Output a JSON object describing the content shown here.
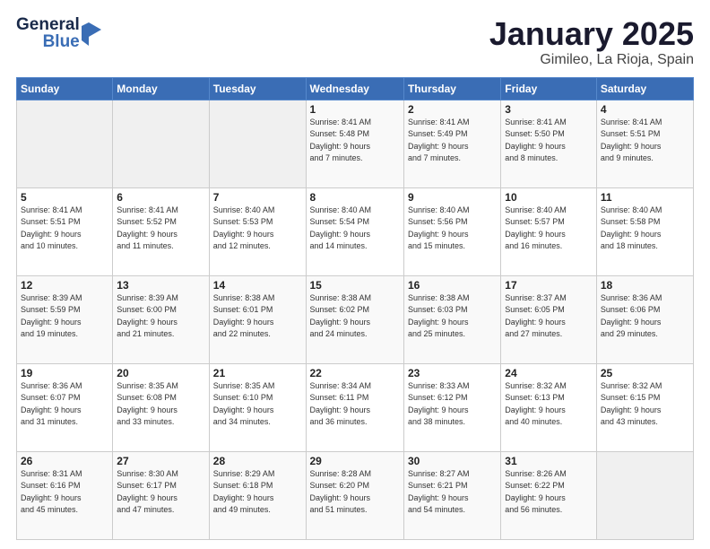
{
  "header": {
    "logo_general": "General",
    "logo_blue": "Blue",
    "month_title": "January 2025",
    "location": "Gimileo, La Rioja, Spain"
  },
  "days_of_week": [
    "Sunday",
    "Monday",
    "Tuesday",
    "Wednesday",
    "Thursday",
    "Friday",
    "Saturday"
  ],
  "weeks": [
    [
      {
        "day": "",
        "sunrise": "",
        "sunset": "",
        "daylight": ""
      },
      {
        "day": "",
        "sunrise": "",
        "sunset": "",
        "daylight": ""
      },
      {
        "day": "",
        "sunrise": "",
        "sunset": "",
        "daylight": ""
      },
      {
        "day": "1",
        "sunrise": "Sunrise: 8:41 AM",
        "sunset": "Sunset: 5:48 PM",
        "daylight": "Daylight: 9 hours and 7 minutes."
      },
      {
        "day": "2",
        "sunrise": "Sunrise: 8:41 AM",
        "sunset": "Sunset: 5:49 PM",
        "daylight": "Daylight: 9 hours and 7 minutes."
      },
      {
        "day": "3",
        "sunrise": "Sunrise: 8:41 AM",
        "sunset": "Sunset: 5:50 PM",
        "daylight": "Daylight: 9 hours and 8 minutes."
      },
      {
        "day": "4",
        "sunrise": "Sunrise: 8:41 AM",
        "sunset": "Sunset: 5:51 PM",
        "daylight": "Daylight: 9 hours and 9 minutes."
      }
    ],
    [
      {
        "day": "5",
        "sunrise": "Sunrise: 8:41 AM",
        "sunset": "Sunset: 5:51 PM",
        "daylight": "Daylight: 9 hours and 10 minutes."
      },
      {
        "day": "6",
        "sunrise": "Sunrise: 8:41 AM",
        "sunset": "Sunset: 5:52 PM",
        "daylight": "Daylight: 9 hours and 11 minutes."
      },
      {
        "day": "7",
        "sunrise": "Sunrise: 8:40 AM",
        "sunset": "Sunset: 5:53 PM",
        "daylight": "Daylight: 9 hours and 12 minutes."
      },
      {
        "day": "8",
        "sunrise": "Sunrise: 8:40 AM",
        "sunset": "Sunset: 5:54 PM",
        "daylight": "Daylight: 9 hours and 14 minutes."
      },
      {
        "day": "9",
        "sunrise": "Sunrise: 8:40 AM",
        "sunset": "Sunset: 5:56 PM",
        "daylight": "Daylight: 9 hours and 15 minutes."
      },
      {
        "day": "10",
        "sunrise": "Sunrise: 8:40 AM",
        "sunset": "Sunset: 5:57 PM",
        "daylight": "Daylight: 9 hours and 16 minutes."
      },
      {
        "day": "11",
        "sunrise": "Sunrise: 8:40 AM",
        "sunset": "Sunset: 5:58 PM",
        "daylight": "Daylight: 9 hours and 18 minutes."
      }
    ],
    [
      {
        "day": "12",
        "sunrise": "Sunrise: 8:39 AM",
        "sunset": "Sunset: 5:59 PM",
        "daylight": "Daylight: 9 hours and 19 minutes."
      },
      {
        "day": "13",
        "sunrise": "Sunrise: 8:39 AM",
        "sunset": "Sunset: 6:00 PM",
        "daylight": "Daylight: 9 hours and 21 minutes."
      },
      {
        "day": "14",
        "sunrise": "Sunrise: 8:38 AM",
        "sunset": "Sunset: 6:01 PM",
        "daylight": "Daylight: 9 hours and 22 minutes."
      },
      {
        "day": "15",
        "sunrise": "Sunrise: 8:38 AM",
        "sunset": "Sunset: 6:02 PM",
        "daylight": "Daylight: 9 hours and 24 minutes."
      },
      {
        "day": "16",
        "sunrise": "Sunrise: 8:38 AM",
        "sunset": "Sunset: 6:03 PM",
        "daylight": "Daylight: 9 hours and 25 minutes."
      },
      {
        "day": "17",
        "sunrise": "Sunrise: 8:37 AM",
        "sunset": "Sunset: 6:05 PM",
        "daylight": "Daylight: 9 hours and 27 minutes."
      },
      {
        "day": "18",
        "sunrise": "Sunrise: 8:36 AM",
        "sunset": "Sunset: 6:06 PM",
        "daylight": "Daylight: 9 hours and 29 minutes."
      }
    ],
    [
      {
        "day": "19",
        "sunrise": "Sunrise: 8:36 AM",
        "sunset": "Sunset: 6:07 PM",
        "daylight": "Daylight: 9 hours and 31 minutes."
      },
      {
        "day": "20",
        "sunrise": "Sunrise: 8:35 AM",
        "sunset": "Sunset: 6:08 PM",
        "daylight": "Daylight: 9 hours and 33 minutes."
      },
      {
        "day": "21",
        "sunrise": "Sunrise: 8:35 AM",
        "sunset": "Sunset: 6:10 PM",
        "daylight": "Daylight: 9 hours and 34 minutes."
      },
      {
        "day": "22",
        "sunrise": "Sunrise: 8:34 AM",
        "sunset": "Sunset: 6:11 PM",
        "daylight": "Daylight: 9 hours and 36 minutes."
      },
      {
        "day": "23",
        "sunrise": "Sunrise: 8:33 AM",
        "sunset": "Sunset: 6:12 PM",
        "daylight": "Daylight: 9 hours and 38 minutes."
      },
      {
        "day": "24",
        "sunrise": "Sunrise: 8:32 AM",
        "sunset": "Sunset: 6:13 PM",
        "daylight": "Daylight: 9 hours and 40 minutes."
      },
      {
        "day": "25",
        "sunrise": "Sunrise: 8:32 AM",
        "sunset": "Sunset: 6:15 PM",
        "daylight": "Daylight: 9 hours and 43 minutes."
      }
    ],
    [
      {
        "day": "26",
        "sunrise": "Sunrise: 8:31 AM",
        "sunset": "Sunset: 6:16 PM",
        "daylight": "Daylight: 9 hours and 45 minutes."
      },
      {
        "day": "27",
        "sunrise": "Sunrise: 8:30 AM",
        "sunset": "Sunset: 6:17 PM",
        "daylight": "Daylight: 9 hours and 47 minutes."
      },
      {
        "day": "28",
        "sunrise": "Sunrise: 8:29 AM",
        "sunset": "Sunset: 6:18 PM",
        "daylight": "Daylight: 9 hours and 49 minutes."
      },
      {
        "day": "29",
        "sunrise": "Sunrise: 8:28 AM",
        "sunset": "Sunset: 6:20 PM",
        "daylight": "Daylight: 9 hours and 51 minutes."
      },
      {
        "day": "30",
        "sunrise": "Sunrise: 8:27 AM",
        "sunset": "Sunset: 6:21 PM",
        "daylight": "Daylight: 9 hours and 54 minutes."
      },
      {
        "day": "31",
        "sunrise": "Sunrise: 8:26 AM",
        "sunset": "Sunset: 6:22 PM",
        "daylight": "Daylight: 9 hours and 56 minutes."
      },
      {
        "day": "",
        "sunrise": "",
        "sunset": "",
        "daylight": ""
      }
    ]
  ]
}
